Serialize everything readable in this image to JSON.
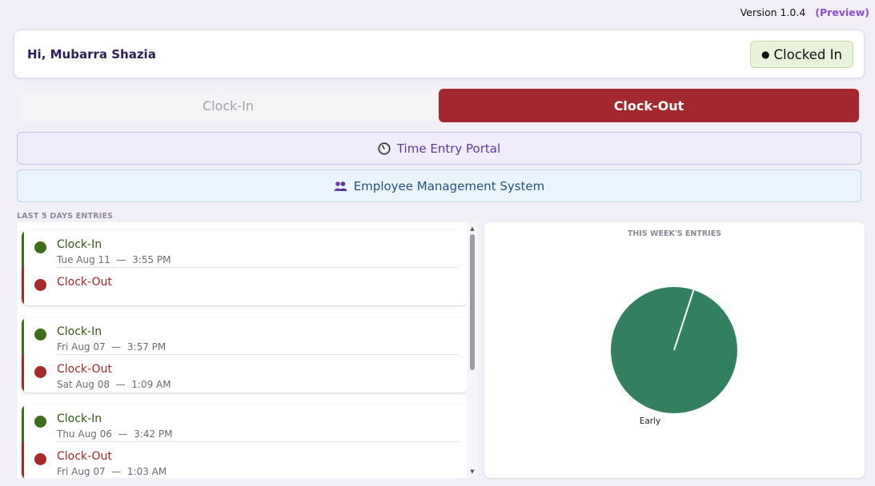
{
  "version": {
    "text": "Version 1.0.4",
    "tag": "(Preview)"
  },
  "greeting": "Hi, Mubarra Shazia",
  "status": {
    "dot": "●",
    "label": "Clocked In"
  },
  "actions": {
    "clock_in": "Clock-In",
    "clock_out": "Clock-Out"
  },
  "links": {
    "portal": {
      "icon": "stopwatch-icon",
      "label": "Time Entry Portal"
    },
    "ems": {
      "icon": "people-icon",
      "label": "Employee Management System"
    }
  },
  "entries_section": {
    "label": "LAST 5 DAYS ENTRIES",
    "cards": [
      {
        "in": {
          "label": "Clock-In",
          "date": "Tue Aug 11",
          "sep": "—",
          "time": "3:55 PM"
        },
        "out": {
          "label": "Clock-Out",
          "date": "",
          "sep": "",
          "time": ""
        }
      },
      {
        "in": {
          "label": "Clock-In",
          "date": "Fri Aug 07",
          "sep": "—",
          "time": "3:57 PM"
        },
        "out": {
          "label": "Clock-Out",
          "date": "Sat Aug 08",
          "sep": "—",
          "time": "1:09 AM"
        }
      },
      {
        "in": {
          "label": "Clock-In",
          "date": "Thu Aug 06",
          "sep": "—",
          "time": "3:42 PM"
        },
        "out": {
          "label": "Clock-Out",
          "date": "Fri Aug 07",
          "sep": "—",
          "time": "1:03 AM"
        }
      }
    ]
  },
  "chart_data": {
    "type": "pie",
    "title": "THIS WEEK'S ENTRIES",
    "slices": [
      {
        "label": "Early",
        "value": 1,
        "color": "#32805f"
      }
    ]
  },
  "colors": {
    "clock_out": "#a3292e",
    "clock_in_accent": "#3f6e1a",
    "clock_out_accent": "#a52a2a",
    "preview": "#8a4fd6"
  }
}
